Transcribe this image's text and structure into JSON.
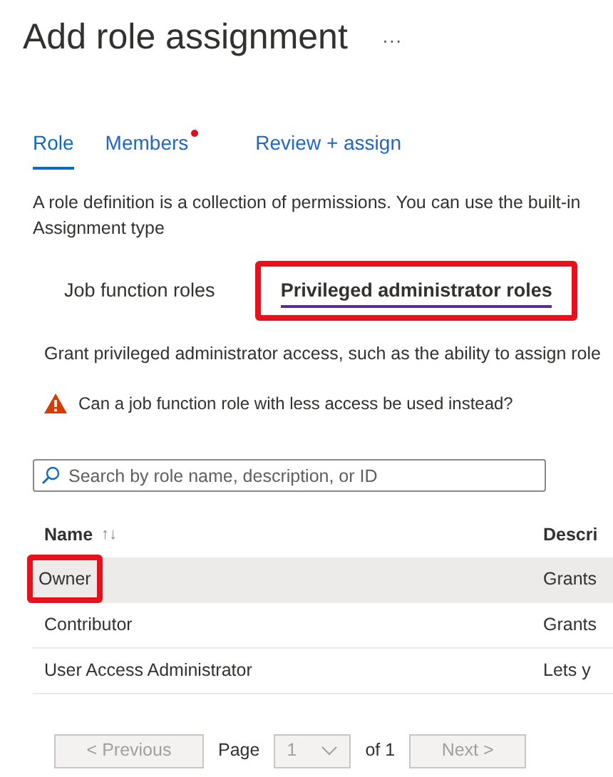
{
  "page": {
    "title": "Add role assignment",
    "more": "···"
  },
  "tabs": [
    {
      "label": "Role",
      "selected": true,
      "attention": false
    },
    {
      "label": "Members",
      "selected": false,
      "attention": true
    },
    {
      "label": "Review + assign",
      "selected": false,
      "attention": false
    }
  ],
  "description": [
    "A role definition is a collection of permissions. You can use the built-in",
    "Assignment type"
  ],
  "role_types": [
    {
      "label": "Job function roles",
      "selected": false,
      "highlighted": false
    },
    {
      "label": "Privileged administrator roles",
      "selected": true,
      "highlighted": true
    }
  ],
  "grant_text": "Grant privileged administrator access, such as the ability to assign role",
  "warning": "Can a job function role with less access be used instead?",
  "search": {
    "placeholder": "Search by role name, description, or ID"
  },
  "table": {
    "columns": [
      {
        "label": "Name",
        "sort": "↑↓"
      },
      {
        "label": "Descri"
      }
    ],
    "rows": [
      {
        "name": "Owner",
        "description": "Grants",
        "selected": true,
        "highlighted": true
      },
      {
        "name": "Contributor",
        "description": "Grants",
        "selected": false,
        "highlighted": false
      },
      {
        "name": "User Access Administrator",
        "description": "Lets y",
        "selected": false,
        "highlighted": false
      }
    ]
  },
  "pagination": {
    "previous": "< Previous",
    "page_label": "Page",
    "page": "1",
    "of": "of 1",
    "next": "Next >"
  }
}
